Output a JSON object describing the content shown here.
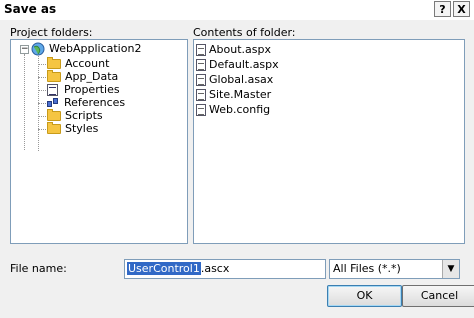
{
  "dialog": {
    "title": "Save as",
    "help_glyph": "?",
    "close_glyph": "X"
  },
  "project_folders": {
    "label": "Project folders:",
    "root": "WebApplication2",
    "items": [
      {
        "label": "Account",
        "icon": "folder-icon"
      },
      {
        "label": "App_Data",
        "icon": "folder-icon"
      },
      {
        "label": "Properties",
        "icon": "properties-icon"
      },
      {
        "label": "References",
        "icon": "references-icon"
      },
      {
        "label": "Scripts",
        "icon": "folder-icon"
      },
      {
        "label": "Styles",
        "icon": "folder-icon"
      }
    ]
  },
  "contents": {
    "label": "Contents of folder:",
    "files": [
      {
        "label": "About.aspx",
        "icon": "aspx-file-icon"
      },
      {
        "label": "Default.aspx",
        "icon": "aspx-file-icon"
      },
      {
        "label": "Global.asax",
        "icon": "asax-file-icon"
      },
      {
        "label": "Site.Master",
        "icon": "master-file-icon"
      },
      {
        "label": "Web.config",
        "icon": "config-file-icon"
      }
    ]
  },
  "file_name": {
    "label": "File name:",
    "selected_part": "UserControl1",
    "rest": ".ascx"
  },
  "file_type": {
    "value": "All Files (*.*)"
  },
  "buttons": {
    "ok": "OK",
    "cancel": "Cancel"
  }
}
